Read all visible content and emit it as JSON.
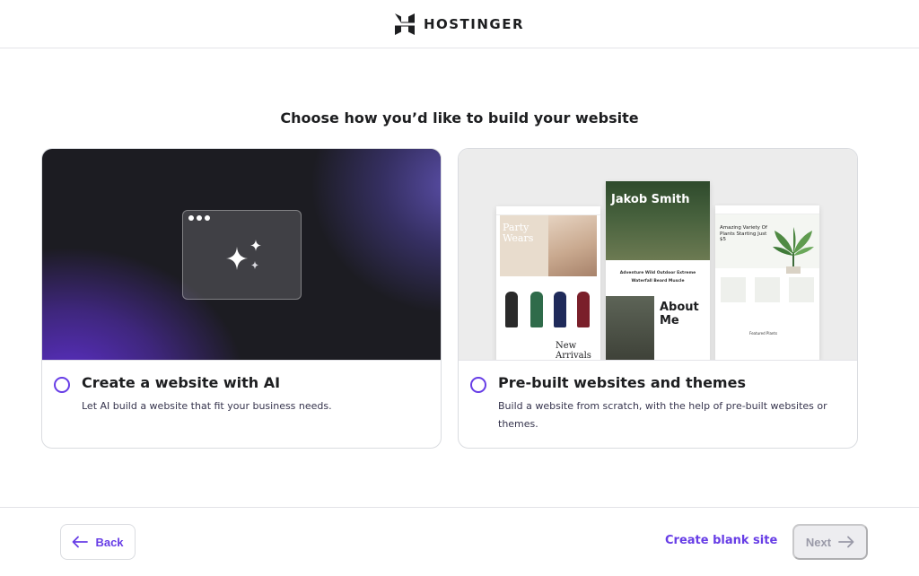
{
  "header": {
    "brand": "HOSTINGER",
    "logo_icon": "hostinger-logo-icon"
  },
  "page": {
    "heading": "Choose how you’d like to build your website"
  },
  "options": [
    {
      "title": "Create a website with AI",
      "description": "Let AI build a website that fit your business needs.",
      "selected": false,
      "icon": "sparkles-icon"
    },
    {
      "title": "Pre-built websites and themes",
      "description": "Build a website from scratch, with the help of pre-built websites or themes.",
      "selected": false
    }
  ],
  "theme_previews": {
    "left": {
      "hero": "Party Wears",
      "section": "New Arrivals"
    },
    "middle": {
      "hero": "Jakob Smith",
      "tags": "Adventure  Wild  Outdoor  Extreme  Waterfall  Beard  Muscle",
      "section": "About Me"
    },
    "right": {
      "hero": "Amazing Variety Of Plants Starting Just $5",
      "section": "Featured Plants"
    }
  },
  "footer": {
    "back_label": "Back",
    "blank_site_label": "Create blank site",
    "next_label": "Next",
    "next_disabled": true
  },
  "colors": {
    "accent": "#673de6",
    "text": "#1d1e20",
    "disabled_bg": "#ededf0",
    "disabled_text": "#9a9aa8"
  }
}
